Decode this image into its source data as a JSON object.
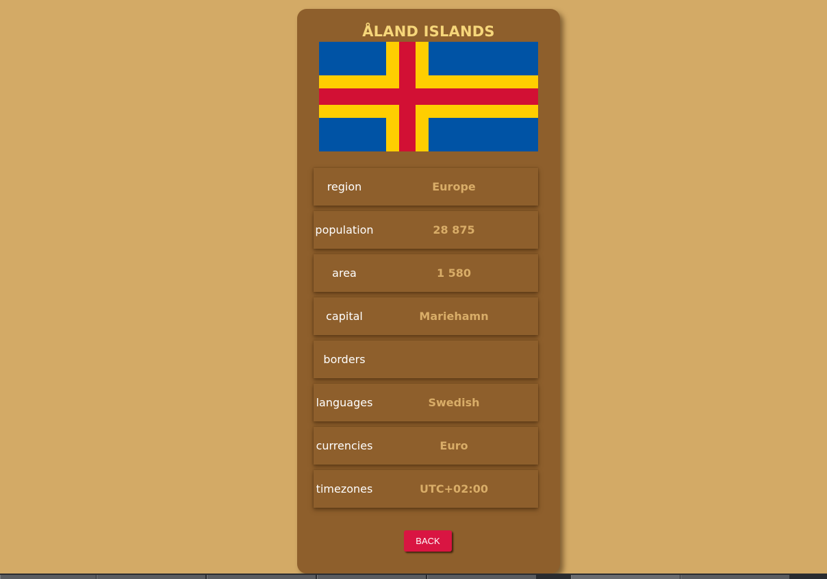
{
  "country": {
    "name": "ÅLAND ISLANDS",
    "flag": {
      "colors": {
        "field": "#0053a5",
        "outer_cross": "#ffce00",
        "inner_cross": "#d21034"
      }
    }
  },
  "details": [
    {
      "label": "region",
      "value": "Europe"
    },
    {
      "label": "population",
      "value": "28 875"
    },
    {
      "label": "area",
      "value": "1 580"
    },
    {
      "label": "capital",
      "value": "Mariehamn"
    },
    {
      "label": "borders",
      "value": ""
    },
    {
      "label": "languages",
      "value": "Swedish"
    },
    {
      "label": "currencies",
      "value": "Euro"
    },
    {
      "label": "timezones",
      "value": "UTC+02:00"
    }
  ],
  "back_button": {
    "label": "BACK"
  },
  "colors": {
    "page_background": "#d3aa66",
    "card_background": "#8e5f2c",
    "title": "#f6d67a",
    "value_text": "#d9ad68",
    "button": "#d91542"
  }
}
